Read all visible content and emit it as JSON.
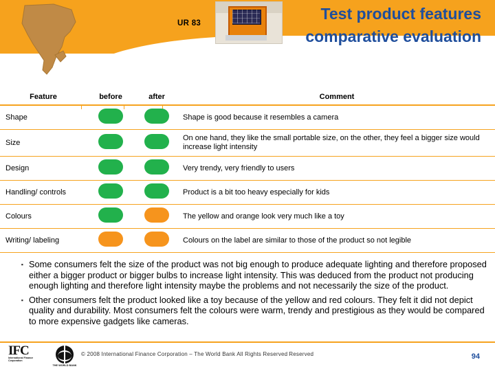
{
  "header": {
    "ur_label": "UR 83",
    "title_line1": "Test product features",
    "title_line2": "comparative evaluation",
    "map_alt": "africa-map",
    "photo_alt": "solar-lamp-photo"
  },
  "table": {
    "columns": [
      "Feature",
      "before",
      "after",
      "Comment"
    ],
    "rows": [
      {
        "feature": "Shape",
        "before": "green",
        "after": "green",
        "comment": "Shape is good because it resembles a camera"
      },
      {
        "feature": "Size",
        "before": "green",
        "after": "green",
        "comment": "On one hand, they like the small portable size, on the other, they feel a bigger size would increase light intensity"
      },
      {
        "feature": "Design",
        "before": "green",
        "after": "green",
        "comment": "Very trendy, very friendly to users"
      },
      {
        "feature": "Handling/ controls",
        "before": "green",
        "after": "green",
        "comment": "Product is a bit too heavy especially for kids"
      },
      {
        "feature": "Colours",
        "before": "green",
        "after": "orange",
        "comment": "The yellow and orange look very much like a toy"
      },
      {
        "feature": "Writing/ labeling",
        "before": "orange",
        "after": "orange",
        "comment": "Colours on the label are similar to those of the product so not legible"
      }
    ]
  },
  "bullets": [
    "Some consumers felt the size of the product was not big enough to produce adequate lighting and therefore proposed either a bigger product or bigger bulbs to increase light intensity. This was deduced from the product not producing enough lighting and therefore light intensity maybe the problems and not necessarily the size of the product.",
    "Other consumers felt the product looked like a toy because of the yellow and red colours. They felt it did not depict quality and durability. Most consumers felt the colours were warm, trendy and prestigious as they would be compared to more expensive gadgets like cameras."
  ],
  "footer": {
    "ifc_mark": "IFC",
    "ifc_sub": "International Finance Corporation",
    "worldbank_text": "THE WORLD BANK",
    "copyright": "© 2008 International Finance Corporation – The World Bank All Rights Reserved",
    "rights": "Reserved",
    "page_number": "94"
  },
  "colors": {
    "orange": "#F6A21D",
    "title_blue": "#1F4E9C",
    "dot_green": "#22B14C",
    "dot_orange": "#F6941D"
  }
}
